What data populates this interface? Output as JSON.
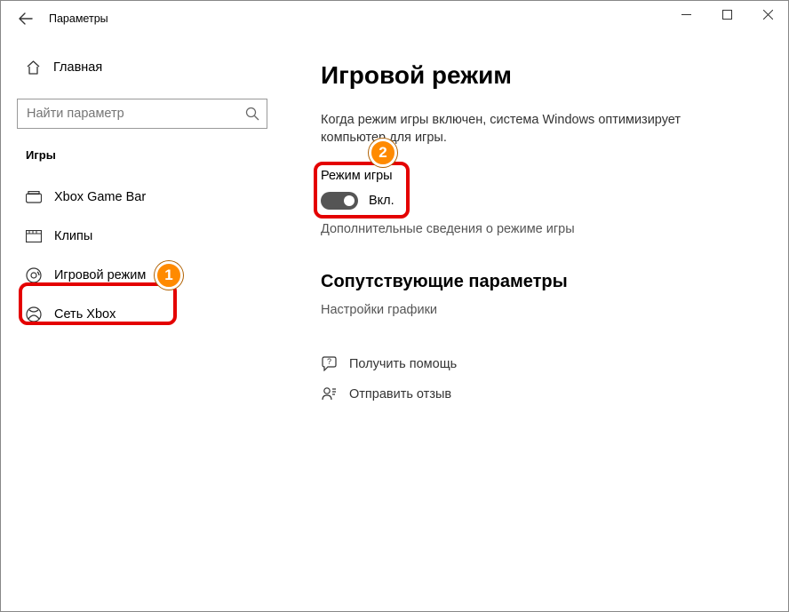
{
  "header": {
    "title": "Параметры"
  },
  "sidebar": {
    "home_label": "Главная",
    "search_placeholder": "Найти параметр",
    "section": "Игры",
    "items": [
      {
        "label": "Xbox Game Bar"
      },
      {
        "label": "Клипы"
      },
      {
        "label": "Игровой режим"
      },
      {
        "label": "Сеть Xbox"
      }
    ]
  },
  "main": {
    "title": "Игровой режим",
    "description": "Когда режим игры включен, система Windows оптимизирует компьютер для игры.",
    "setting_label": "Режим игры",
    "toggle_text": "Вкл.",
    "more_info": "Дополнительные сведения о режиме игры",
    "related_heading": "Сопутствующие параметры",
    "related_link": "Настройки графики",
    "help": "Получить помощь",
    "feedback": "Отправить отзыв"
  },
  "callouts": {
    "one": "1",
    "two": "2"
  }
}
